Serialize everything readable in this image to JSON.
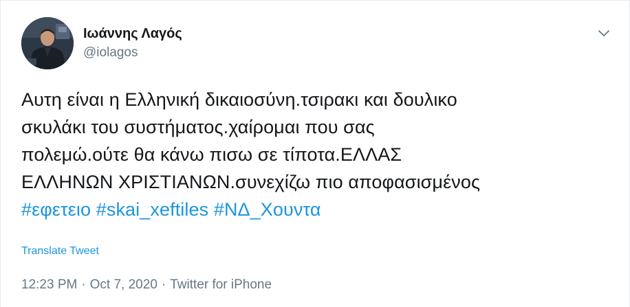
{
  "tweet": {
    "author": {
      "display_name": "Ιωάννης Λαγός",
      "handle": "@iolagos"
    },
    "text_lines": [
      "Αυτη είναι η Ελληνική δικαιοσύνη.τσιρακι και δουλικο",
      "σκυλάκι του συστήματος.χαίρομαι που σας",
      "πολεμώ.ούτε θα κάνω πισω σε τίποτα.ΕΛΛΑΣ",
      "ΕΛΛΗΝΩΝ ΧΡΙΣΤΙΑΝΩΝ.συνεχίζω πιο αποφασισμένος"
    ],
    "hashtags": [
      "#εφετειο",
      "#skai_xeftiles",
      "#ΝΔ_Χουντα"
    ],
    "translate_label": "Translate Tweet",
    "time": "12:23 PM",
    "separator": "·",
    "date": "Oct 7, 2020",
    "source": "Twitter for iPhone",
    "icons": {
      "menu": "chevron-down-icon"
    },
    "colors": {
      "link": "#1b95e0",
      "secondary_text": "#657786",
      "text": "#14171a"
    }
  }
}
